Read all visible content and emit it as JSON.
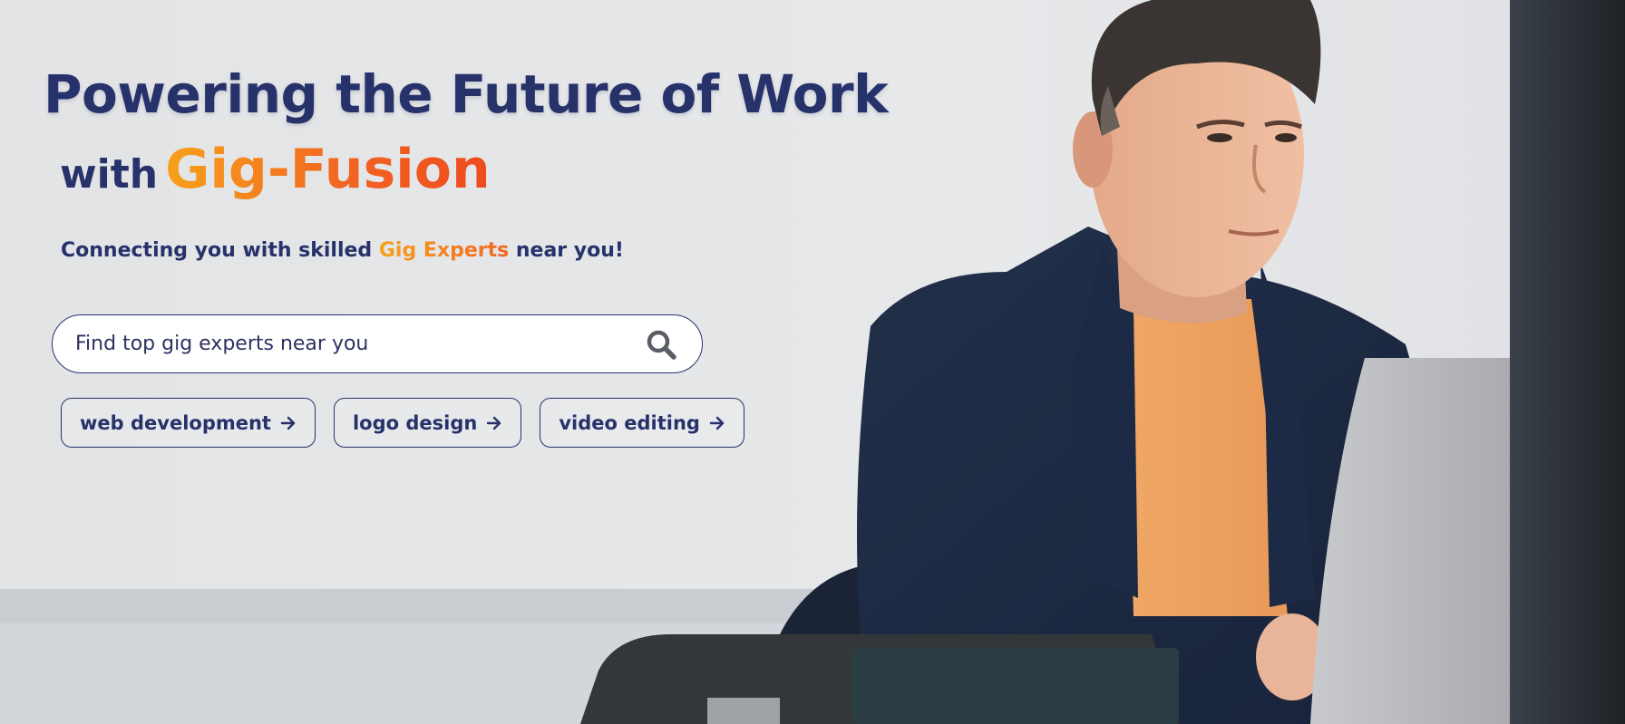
{
  "hero": {
    "headline_line1": "Powering the Future of Work",
    "headline_with": "with",
    "headline_brand": "Gig-Fusion",
    "tagline_before": "Connecting you with skilled ",
    "tagline_accent": "Gig Experts",
    "tagline_after": " near you!"
  },
  "search": {
    "placeholder": "Find top gig experts near you",
    "icon": "search-icon"
  },
  "quick_links": [
    {
      "label": "web development",
      "icon": "arrow-right-icon"
    },
    {
      "label": "logo design",
      "icon": "arrow-right-icon"
    },
    {
      "label": "video editing",
      "icon": "arrow-right-icon"
    }
  ],
  "colors": {
    "navy": "#27316a",
    "brand_orange_start": "#f7a11b",
    "brand_orange_end": "#ee4b1f",
    "background": "#e3e5e7"
  },
  "background_image": "man-working-on-laptop"
}
